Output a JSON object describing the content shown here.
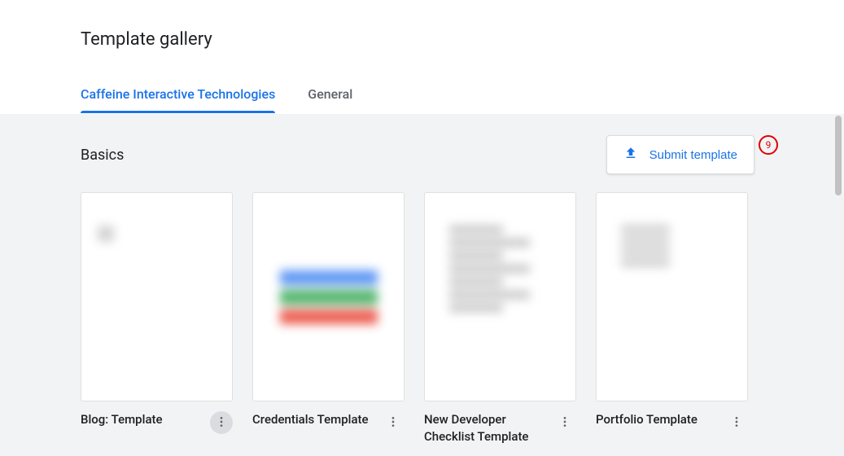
{
  "page_title": "Template gallery",
  "tabs": [
    {
      "label": "Caffeine Interactive Technologies",
      "active": true
    },
    {
      "label": "General",
      "active": false
    }
  ],
  "section": {
    "title": "Basics",
    "submit_button_label": "Submit template"
  },
  "annotation_badge": "9",
  "templates": [
    {
      "title": "Blog: Template",
      "more_highlighted": true
    },
    {
      "title": "Credentials Template",
      "more_highlighted": false
    },
    {
      "title": "New Developer Checklist Template",
      "more_highlighted": false
    },
    {
      "title": "Portfolio Template",
      "more_highlighted": false
    }
  ]
}
